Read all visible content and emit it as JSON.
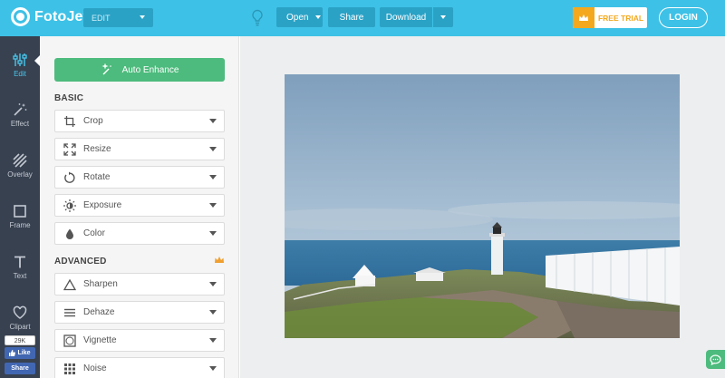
{
  "app": {
    "logo_text": "FotoJet",
    "mode": "EDIT"
  },
  "toolbar": {
    "open_label": "Open",
    "share_label": "Share",
    "download_label": "Download",
    "trial_label": "FREE TRIAL",
    "login_label": "LOGIN"
  },
  "nav": {
    "items": [
      {
        "label": "Edit",
        "icon": "sliders-icon",
        "active": true
      },
      {
        "label": "Effect",
        "icon": "magic-wand-icon",
        "active": false
      },
      {
        "label": "Overlay",
        "icon": "stripes-icon",
        "active": false
      },
      {
        "label": "Frame",
        "icon": "frame-icon",
        "active": false
      },
      {
        "label": "Text",
        "icon": "text-icon",
        "active": false
      },
      {
        "label": "Clipart",
        "icon": "heart-icon",
        "active": false
      }
    ],
    "social": {
      "like_count": "29K",
      "like_label": "Like",
      "share_label": "Share"
    }
  },
  "panel": {
    "enhance_label": "Auto Enhance",
    "basic_title": "BASIC",
    "advanced_title": "ADVANCED",
    "basic_tools": [
      {
        "label": "Crop",
        "icon": "crop-icon"
      },
      {
        "label": "Resize",
        "icon": "resize-icon"
      },
      {
        "label": "Rotate",
        "icon": "rotate-icon"
      },
      {
        "label": "Exposure",
        "icon": "exposure-icon"
      },
      {
        "label": "Color",
        "icon": "droplet-icon"
      }
    ],
    "advanced_tools": [
      {
        "label": "Sharpen",
        "icon": "triangle-icon"
      },
      {
        "label": "Dehaze",
        "icon": "dehaze-icon"
      },
      {
        "label": "Vignette",
        "icon": "vignette-icon"
      },
      {
        "label": "Noise",
        "icon": "noise-grid-icon"
      }
    ]
  },
  "colors": {
    "header": "#3ec1e6",
    "header_button": "#2aa2c6",
    "nav_bg": "#374150",
    "nav_active": "#48c7ec",
    "accent_green": "#4dbb7d",
    "trial_orange": "#f4a81d",
    "facebook_blue": "#4267b2"
  }
}
